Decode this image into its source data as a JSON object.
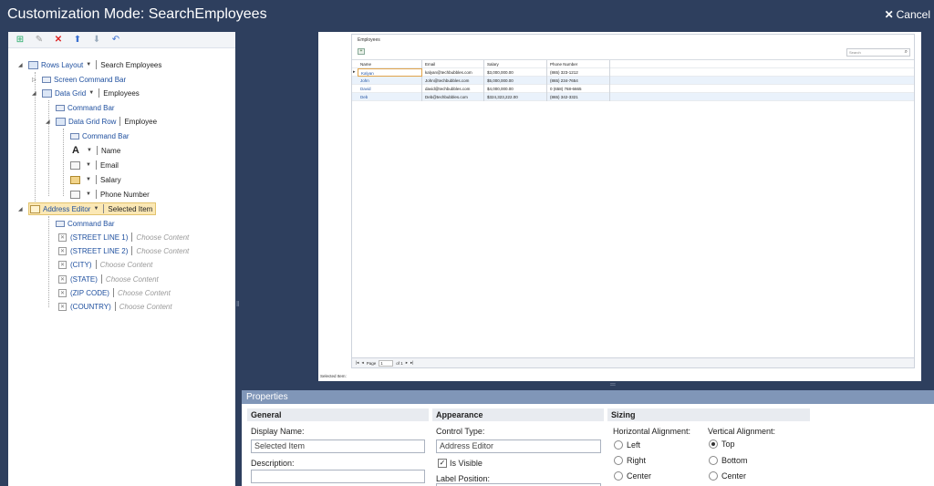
{
  "window": {
    "title": "Customization Mode: SearchEmployees",
    "cancel_label": "Cancel"
  },
  "toolbar": {
    "icons": [
      "add-item-icon",
      "edit-item-icon",
      "delete-icon",
      "move-up-icon",
      "move-down-icon",
      "reset-icon"
    ]
  },
  "tree": {
    "rows_layout": {
      "type": "Rows Layout",
      "name": "Search Employees"
    },
    "screen_command_bar": "Screen Command Bar",
    "data_grid": {
      "type": "Data Grid",
      "name": "Employees"
    },
    "data_grid_command_bar": "Command Bar",
    "data_grid_row": {
      "type": "Data Grid Row",
      "name": "Employee"
    },
    "row_command_bar": "Command Bar",
    "fields": [
      "Name",
      "Email",
      "Salary",
      "Phone Number"
    ],
    "address_editor": {
      "type": "Address Editor",
      "name": "Selected Item"
    },
    "address_command_bar": "Command Bar",
    "address_parts": [
      "(STREET LINE 1)",
      "(STREET LINE 2)",
      "(CITY)",
      "(STATE)",
      "(ZIP CODE)",
      "(COUNTRY)"
    ],
    "choose_content": "Choose Content"
  },
  "preview": {
    "title": "Employees",
    "search_placeholder": "Search",
    "headers": [
      "Name",
      "Email",
      "Salary",
      "Phone Number"
    ],
    "rows": [
      [
        "Kalyan",
        "kalyan@techbubbles.com",
        "$3,000,000.00",
        "(865) 323-1212"
      ],
      [
        "John",
        "John@techbubbles.com",
        "$5,000,000.00",
        "(865) 234-7654"
      ],
      [
        "David",
        "david@techbubbles.com",
        "$4,000,000.00",
        "0 (658) 768-6665"
      ],
      [
        "Deb",
        "Deb@techbubbles.com",
        "$324,323,222.00",
        "(865) 342-3321"
      ]
    ],
    "pager": {
      "page_label": "Page",
      "page_value": "1",
      "of_label": "of 1"
    },
    "status": "Selected Item:"
  },
  "properties": {
    "header": "Properties",
    "general": {
      "title": "General",
      "display_name_label": "Display Name:",
      "display_name_value": "Selected Item",
      "description_label": "Description:"
    },
    "appearance": {
      "title": "Appearance",
      "control_type_label": "Control Type:",
      "control_type_value": "Address Editor",
      "is_visible_label": "Is Visible",
      "label_position_label": "Label Position:"
    },
    "sizing": {
      "title": "Sizing",
      "horizontal_label": "Horizontal Alignment:",
      "horizontal_options": [
        "Left",
        "Right",
        "Center"
      ],
      "vertical_label": "Vertical Alignment:",
      "vertical_options": [
        "Top",
        "Bottom",
        "Center"
      ],
      "vertical_selected": "Top"
    }
  },
  "colors": {
    "background": "#2e3f5e",
    "properties_header": "#8096b8",
    "highlight": "#fbe8b5",
    "link": "#2152a3"
  }
}
